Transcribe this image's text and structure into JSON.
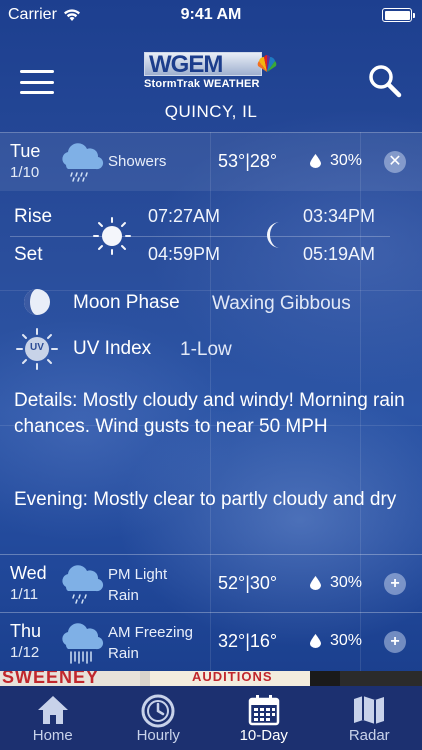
{
  "status_bar": {
    "carrier": "Carrier",
    "time": "9:41 AM"
  },
  "header": {
    "logo_text": "WGEM",
    "logo_subtitle": "StormTrak WEATHER",
    "location": "QUINCY, IL"
  },
  "days": [
    {
      "day": "Tue",
      "date": "1/10",
      "icon": "showers-icon",
      "condition": "Showers",
      "temps": "53°|28°",
      "precip": "30%",
      "action": "✕",
      "expanded": true
    },
    {
      "day": "Wed",
      "date": "1/11",
      "icon": "light-rain-icon",
      "condition_line1": "PM Light",
      "condition_line2": "Rain",
      "temps": "52°|30°",
      "precip": "30%",
      "action": "+"
    },
    {
      "day": "Thu",
      "date": "1/12",
      "icon": "freezing-rain-icon",
      "condition_line1": "AM Freezing",
      "condition_line2": "Rain",
      "temps": "32°|16°",
      "precip": "30%",
      "action": "+"
    }
  ],
  "expanded": {
    "rise_label": "Rise",
    "set_label": "Set",
    "sunrise": "07:27AM",
    "sunset": "04:59PM",
    "moonrise": "03:34PM",
    "moonset": "05:19AM",
    "moon_phase_label": "Moon Phase",
    "moon_phase_value": "Waxing Gibbous",
    "uv_label": "UV Index",
    "uv_value": "1-Low",
    "uv_badge": "UV",
    "details": "Details: Mostly cloudy and windy! Morning rain chances.  Wind gusts to near 50 MPH",
    "evening": "Evening: Mostly clear to partly cloudy and dry"
  },
  "ad": {
    "text1": "SWEENEY",
    "text2": "AUDITIONS"
  },
  "tabs": [
    {
      "label": "Home",
      "icon": "home-icon"
    },
    {
      "label": "Hourly",
      "icon": "clock-icon"
    },
    {
      "label": "10-Day",
      "icon": "calendar-icon",
      "active": true
    },
    {
      "label": "Radar",
      "icon": "map-icon"
    }
  ],
  "colors": {
    "background": "#1b3e8a",
    "tabbar": "#1c3070",
    "accent": "#ffffff"
  }
}
